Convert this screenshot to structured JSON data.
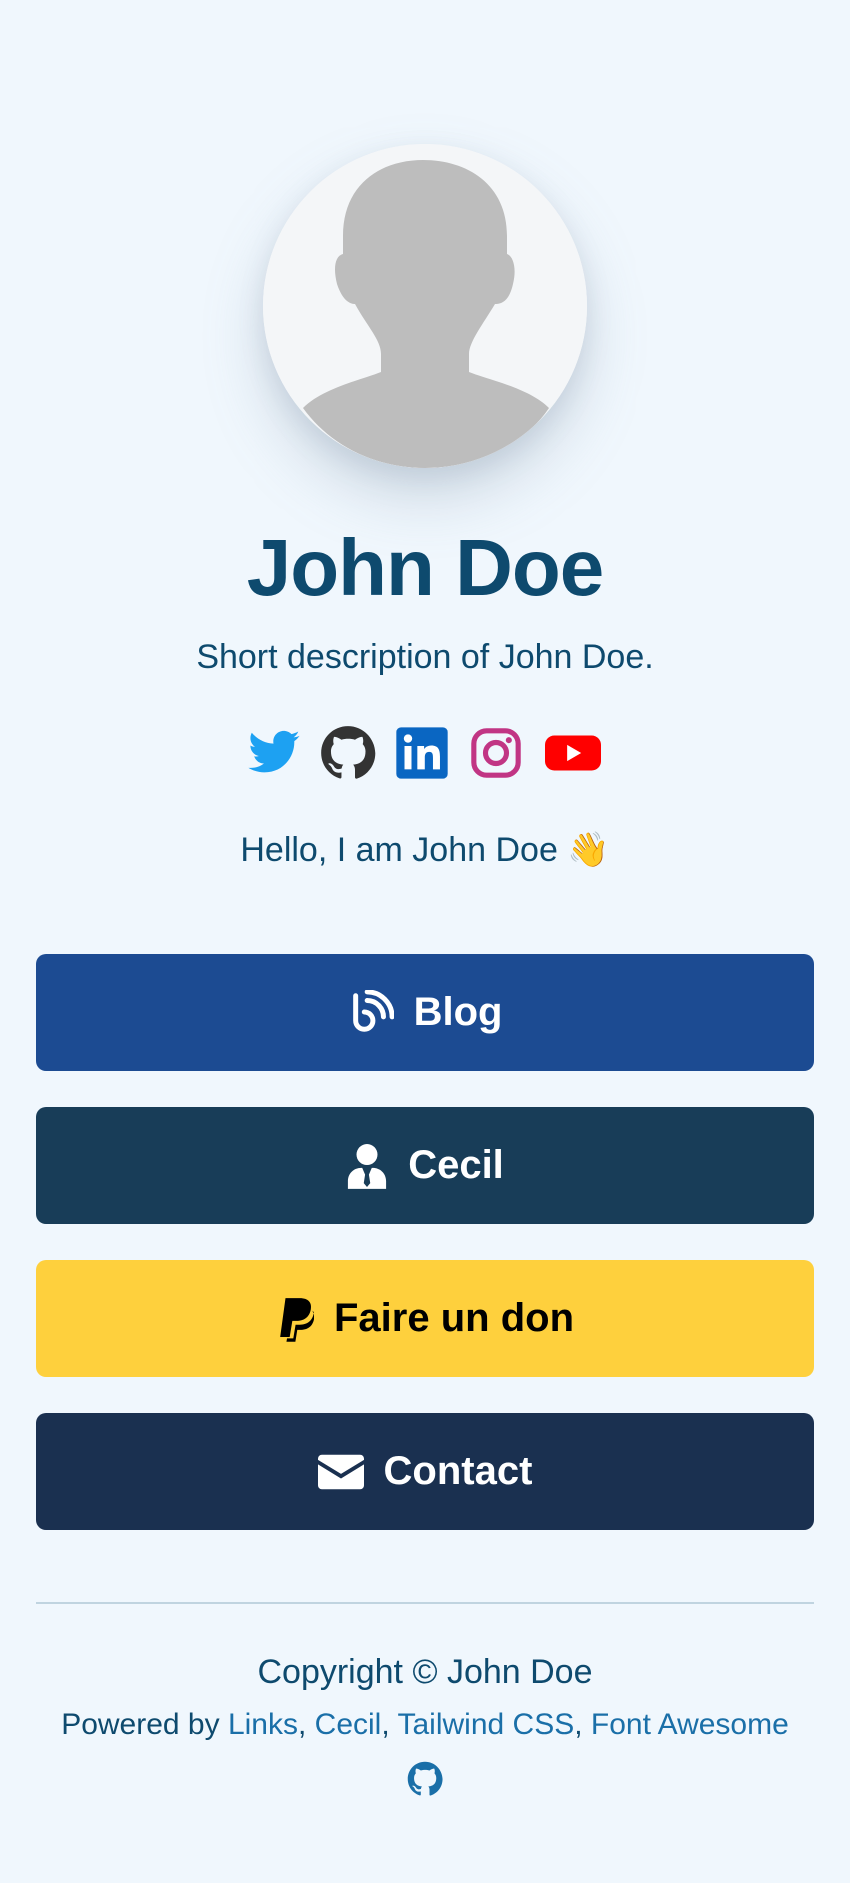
{
  "profile": {
    "name": "John Doe",
    "description": "Short description of John Doe.",
    "greeting": "Hello, I am John Doe 👋"
  },
  "socials": [
    {
      "icon": "twitter-icon",
      "color": "#1da1f2"
    },
    {
      "icon": "github-icon",
      "color": "#333333"
    },
    {
      "icon": "linkedin-icon",
      "color": "#0a66c2"
    },
    {
      "icon": "instagram-icon",
      "color": "#c13584"
    },
    {
      "icon": "youtube-icon",
      "color": "#ff0000"
    }
  ],
  "buttons": {
    "blog": {
      "label": "Blog",
      "icon": "blog-icon",
      "color": "#1c4b92"
    },
    "cecil": {
      "label": "Cecil",
      "icon": "user-tie-icon",
      "color": "#183d58"
    },
    "donate": {
      "label": "Faire un don",
      "icon": "paypal-icon",
      "color": "#fed03d"
    },
    "contact": {
      "label": "Contact",
      "icon": "envelope-icon",
      "color": "#1a3050"
    }
  },
  "footer": {
    "copyright": "Copyright © John Doe",
    "powered_prefix": "Powered by ",
    "links": [
      "Links",
      "Cecil",
      "Tailwind CSS",
      "Font Awesome"
    ],
    "separator": ", ",
    "source_icon": "github-icon"
  }
}
